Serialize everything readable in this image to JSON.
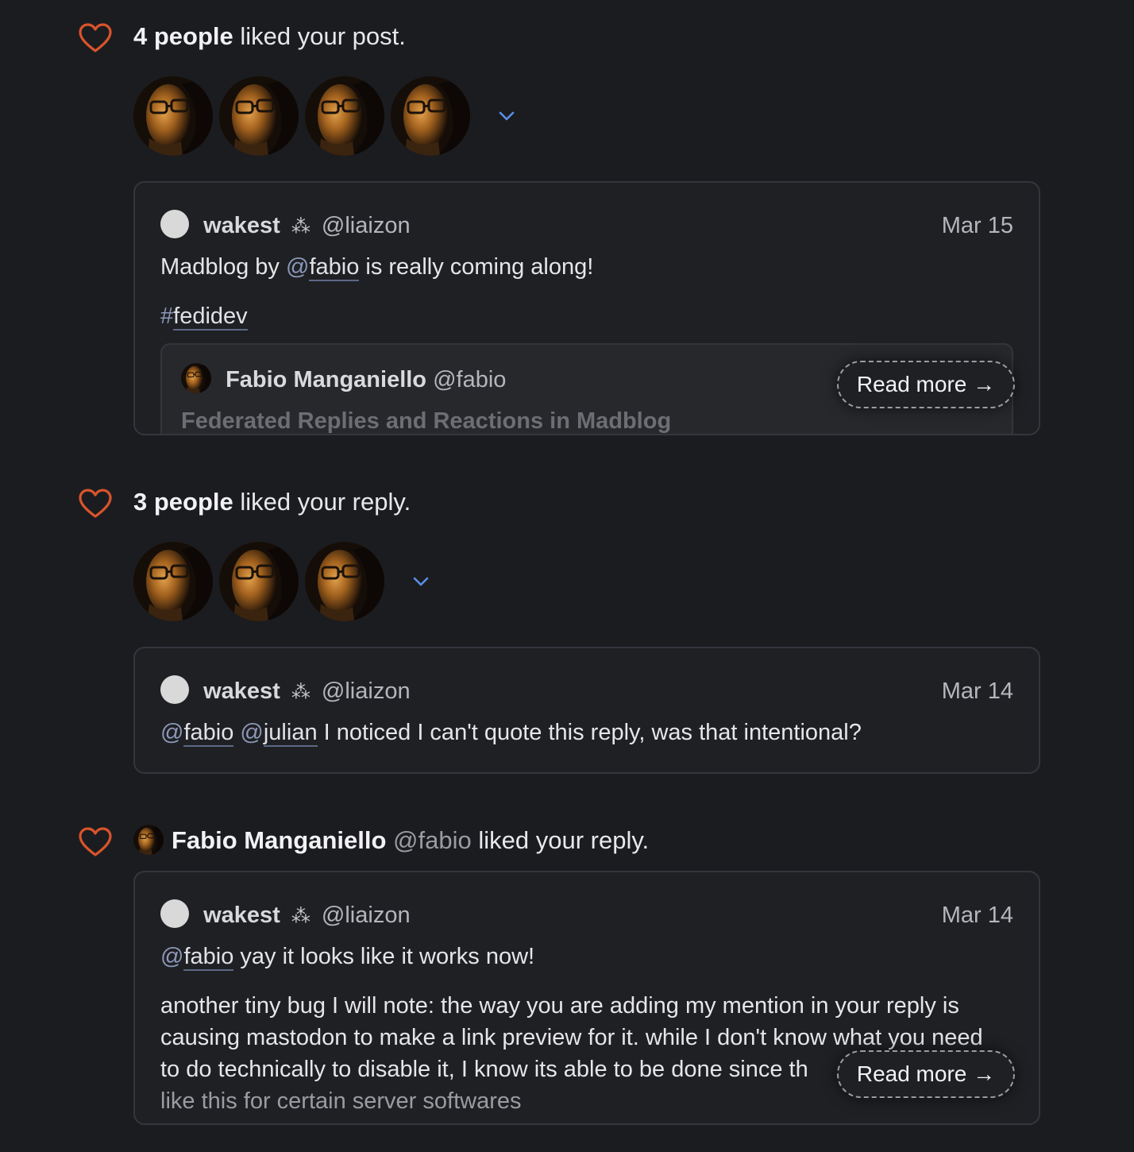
{
  "notifications": [
    {
      "count_label": "4 people",
      "action_text": "liked your post.",
      "post": {
        "author_name": "wakest",
        "author_emoji": "⁂",
        "author_handle": "@liaizon",
        "date": "Mar 15",
        "text_pre": "Madblog by ",
        "mention1_at": "@",
        "mention1_name": "fabio",
        "text_post": " is really coming along!",
        "hashtag_hash": "#",
        "hashtag_word": "fedidev",
        "quote": {
          "author_name": "Fabio Manganiello",
          "author_handle": "@fabio",
          "title": "Federated Replies and Reactions in Madblog"
        },
        "read_more": "Read more →"
      }
    },
    {
      "count_label": "3 people",
      "action_text": "liked your reply.",
      "post": {
        "author_name": "wakest",
        "author_emoji": "⁂",
        "author_handle": "@liaizon",
        "date": "Mar 14",
        "mention1_at": "@",
        "mention1_name": "fabio",
        "mention2_at": "@",
        "mention2_name": "julian",
        "text_post": " I noticed I can't quote this reply, was that intentional?"
      }
    },
    {
      "liker_name": "Fabio Manganiello",
      "liker_handle": "@fabio",
      "action_text": "liked your reply.",
      "post": {
        "author_name": "wakest",
        "author_emoji": "⁂",
        "author_handle": "@liaizon",
        "date": "Mar 14",
        "mention1_at": "@",
        "mention1_name": "fabio",
        "text_post": " yay it looks like it works now!",
        "line1": "another tiny bug I will note: the way you are adding my mention in your reply is",
        "line2": "causing mastodon to make a link preview for it. while I don't know what you need",
        "line3": "to do technically to disable it, I know its able to be done since th",
        "line4": "like this for certain server softwares",
        "read_more": "Read more →"
      }
    }
  ],
  "icons": {
    "like": "heart-icon",
    "expand": "chevron-down-icon"
  },
  "colors": {
    "heart": "#d9542b",
    "background": "#1b1c20",
    "link": "#8b98b8",
    "chevron": "#5a8ee6"
  }
}
